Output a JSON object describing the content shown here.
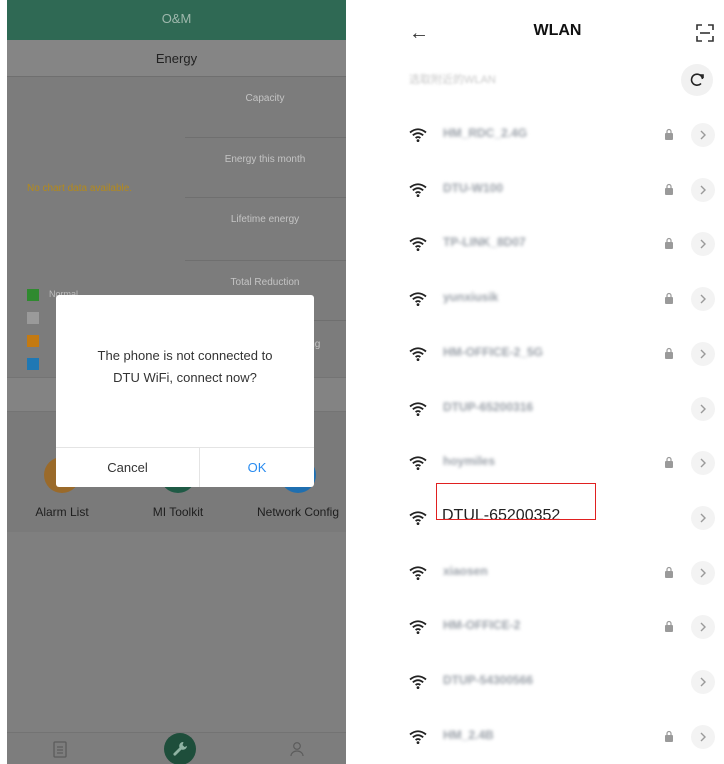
{
  "left_app": {
    "title": "O&M",
    "energy_header": "Energy",
    "stats": [
      "Capacity",
      "Energy this month",
      "Lifetime energy",
      "Total Reduction",
      "ing"
    ],
    "no_chart_text": "No chart data available.",
    "legend": [
      {
        "label": "Normal",
        "color": "#2f8a2f"
      },
      {
        "label": "",
        "color": "#9a9a9a"
      },
      {
        "label": "",
        "color": "#c47a12"
      },
      {
        "label": "",
        "color": "#1f78b4"
      }
    ],
    "tools": [
      {
        "label": "Alarm List",
        "icon": "alarm-list-icon",
        "color": "#9a6a2a"
      },
      {
        "label": "MI Toolkit",
        "icon": "mi-toolkit-icon",
        "color": "#1f5a45"
      },
      {
        "label": "Network Config",
        "icon": "network-config-icon",
        "color": "#1f6fb0"
      }
    ],
    "tabbar": [
      {
        "icon": "clipboard-icon"
      },
      {
        "icon": "wrench-icon"
      },
      {
        "icon": "user-icon"
      }
    ],
    "dialog": {
      "message_line1": "The phone is not connected to",
      "message_line2": "DTU WiFi, connect now?",
      "cancel": "Cancel",
      "ok": "OK"
    }
  },
  "right_app": {
    "title": "WLAN",
    "subtitle": "选取附近的WLAN",
    "networks": [
      {
        "ssid": "HM_RDC_2.4G",
        "locked": true
      },
      {
        "ssid": "DTU-W100",
        "locked": true
      },
      {
        "ssid": "TP-LINK_8D07",
        "locked": true
      },
      {
        "ssid": "yunxiusik",
        "locked": true
      },
      {
        "ssid": "HM-OFFICE-2_5G",
        "locked": true
      },
      {
        "ssid": "DTUP-65200316",
        "locked": false
      },
      {
        "ssid": "hoymiles",
        "locked": true
      },
      {
        "ssid": "DTUL-65200352",
        "locked": false,
        "highlighted": true
      },
      {
        "ssid": "xiaosen",
        "locked": true
      },
      {
        "ssid": "HM-OFFICE-2",
        "locked": true
      },
      {
        "ssid": "DTUP-54300566",
        "locked": false
      },
      {
        "ssid": "HM_2.4B",
        "locked": true
      }
    ]
  }
}
